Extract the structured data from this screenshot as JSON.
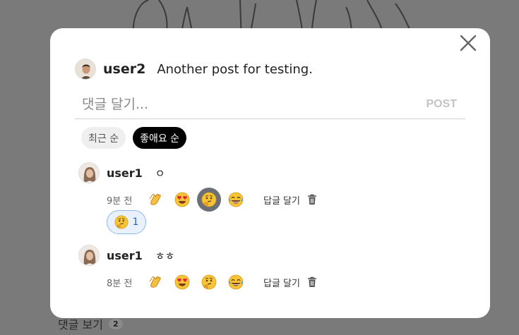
{
  "post": {
    "username": "user2",
    "text": "Another post for testing."
  },
  "comment_input": {
    "placeholder": "댓글 달기...",
    "post_label": "POST"
  },
  "sort_tabs": [
    {
      "label": "최근 순",
      "active": false
    },
    {
      "label": "좋애요 순",
      "active": true
    }
  ],
  "comments": [
    {
      "username": "user1",
      "text": "ㅇ",
      "time": "9분 전",
      "reply_label": "답글 달기",
      "selected_reaction": "thinking-face",
      "reaction_summary": {
        "emoji": "thinking-face",
        "count": "1"
      }
    },
    {
      "username": "user1",
      "text": "ㅎㅎ",
      "time": "8분 전",
      "reply_label": "답글 달기",
      "selected_reaction": null
    }
  ],
  "reaction_options": [
    "clapping-hands",
    "heart-eyes-face",
    "thinking-face",
    "tears-of-joy-face"
  ],
  "background": {
    "comments_label": "댓글 보기",
    "comments_count": "2"
  },
  "colors": {
    "overlay": "#7a7a7a",
    "active_tab": "#000000",
    "selected_reaction_bg": "#6b6f76",
    "pill_border": "#8cb8f0",
    "pill_text": "#2a62c9",
    "post_disabled": "#c4c4c4"
  }
}
